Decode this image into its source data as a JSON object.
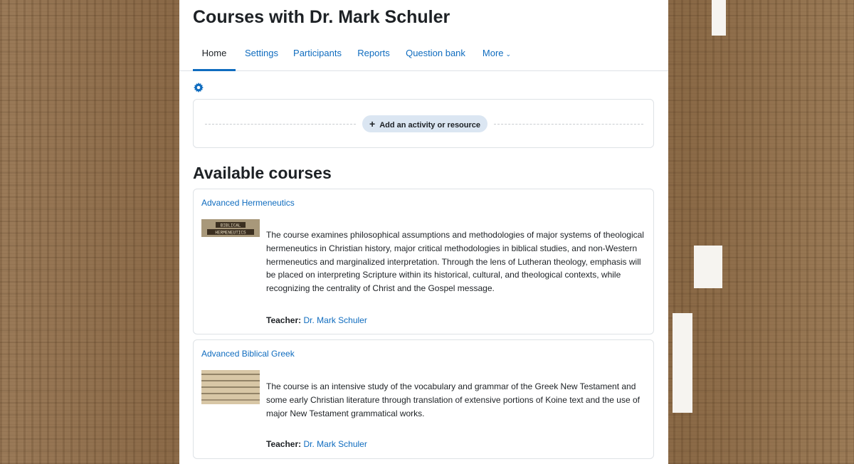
{
  "page": {
    "title": "Courses with Dr. Mark Schuler"
  },
  "nav": {
    "tabs": [
      {
        "label": "Home"
      },
      {
        "label": "Settings"
      },
      {
        "label": "Participants"
      },
      {
        "label": "Reports"
      },
      {
        "label": "Question bank"
      },
      {
        "label": "More"
      }
    ]
  },
  "actions": {
    "add_label": "Add an activity or resource"
  },
  "available": {
    "heading": "Available courses",
    "courses": [
      {
        "name": "Advanced Hermeneutics",
        "image_text": "BIBLICAL HERMENEUTICS",
        "summary": "The course examines philosophical assumptions and methodologies of major systems of theological hermeneutics in Christian history, major critical methodologies in biblical studies, and non-Western hermeneutics and marginalized interpretation. Through the lens of Lutheran theology, emphasis will be placed on interpreting Scripture within its historical, cultural, and theological contexts, while recognizing the centrality of Christ and the Gospel message.",
        "teacher_label": "Teacher:",
        "teacher_name": "Dr. Mark Schuler"
      },
      {
        "name": "Advanced Biblical Greek",
        "summary": "The course is an intensive study of the vocabulary and grammar of the Greek New Testament and some early Christian literature through translation of extensive portions of Koine text and the use of major New Testament grammatical works.",
        "teacher_label": "Teacher:",
        "teacher_name": "Dr. Mark Schuler"
      }
    ]
  },
  "colors": {
    "link": "#0f6cbf",
    "text": "#1d2125",
    "add_button_bg": "#dbe6f2",
    "border": "#dee2e6"
  },
  "icons": {
    "gear": "gear-icon",
    "plus": "plus-icon",
    "chevron": "chevron-down-icon"
  }
}
